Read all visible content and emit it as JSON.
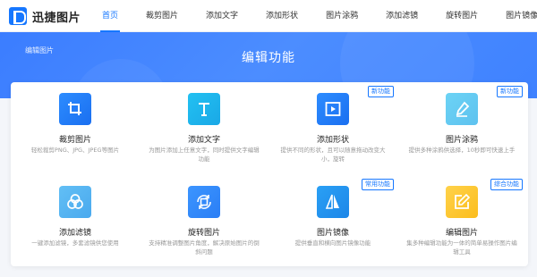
{
  "brand": {
    "name": "迅捷图片"
  },
  "nav": {
    "items": [
      {
        "label": "首页",
        "active": true
      },
      {
        "label": "裁剪图片"
      },
      {
        "label": "添加文字"
      },
      {
        "label": "添加形状"
      },
      {
        "label": "图片涂鸦"
      },
      {
        "label": "添加滤镜"
      },
      {
        "label": "旋转图片"
      },
      {
        "label": "图片镜像"
      }
    ]
  },
  "banner": {
    "breadcrumb": "编辑图片",
    "title": "编辑功能"
  },
  "features": [
    {
      "title": "裁剪图片",
      "desc": "轻松裁剪PNG、JPG、JPEG等图片",
      "badge": "",
      "icon": "crop-icon",
      "color": "#1a6ff0"
    },
    {
      "title": "添加文字",
      "desc": "为图片添加上任意文字，同时提供文字编辑功能",
      "badge": "",
      "icon": "text-icon",
      "color": "#1aa8e6"
    },
    {
      "title": "添加形状",
      "desc": "提供不同的形状，且可以随意拖动改变大小，旋转",
      "badge": "新功能",
      "icon": "shape-icon",
      "color": "#1a6ff0"
    },
    {
      "title": "图片涂鸦",
      "desc": "提供多种涂鸦供选择，10秒即可快速上手",
      "badge": "新功能",
      "icon": "brush-icon",
      "color": "#5ec2ef"
    },
    {
      "title": "添加滤镜",
      "desc": "一键添加滤镜，多套滤镜供您使用",
      "badge": "",
      "icon": "filter-icon",
      "color": "#4aa9ee"
    },
    {
      "title": "旋转图片",
      "desc": "支持精准调整图片角度，解决原始图片的倒斜问题",
      "badge": "",
      "icon": "rotate-icon",
      "color": "#2a7ef5"
    },
    {
      "title": "图片镜像",
      "desc": "提供垂直和横向图片镜像功能",
      "badge": "常用功能",
      "icon": "mirror-icon",
      "color": "#1c86e8"
    },
    {
      "title": "编辑图片",
      "desc": "集多种编辑功能为一体的简单易操作图片编辑工具",
      "badge": "综合功能",
      "icon": "edit-icon",
      "color": "#fbbd1d"
    }
  ],
  "colors": {
    "accent": "#1677ff",
    "banner": "#3f82ff"
  }
}
